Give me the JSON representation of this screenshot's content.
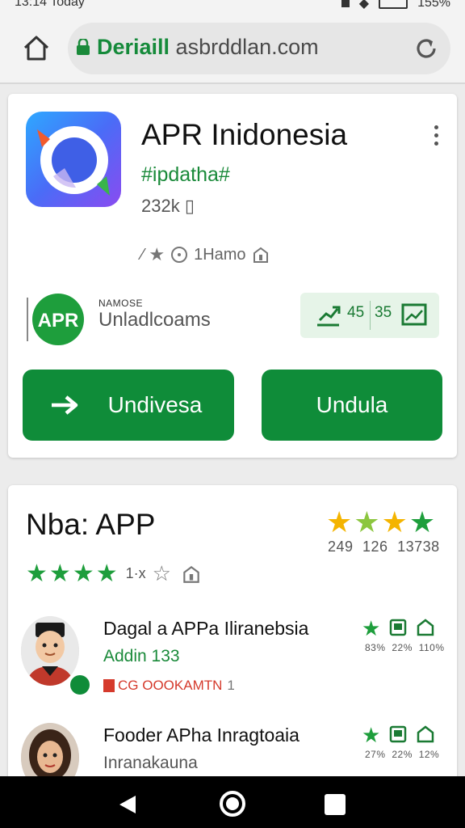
{
  "status_bar": {
    "time": "13:14",
    "extra": "Today",
    "battery": "155%"
  },
  "browser": {
    "url_domain": "Deriaill",
    "url_rest": " asbrddlan.com"
  },
  "app_card": {
    "title": "APR Inidonesia",
    "tag": "#ipdatha#",
    "size": "232k",
    "meta_text": "1Hamo",
    "publisher_small": "NAMOSE",
    "publisher_logo_text": "APR",
    "publisher_name": "Unladlcoams",
    "stat_1": "45",
    "stat_2": "35",
    "install_button": "Undivesa",
    "open_button": "Undula"
  },
  "section": {
    "title": "Nba: APP",
    "stats_numbers": "249 126  13738",
    "rating_text": "1·x"
  },
  "items": [
    {
      "title": "Dagal a APPa Iliranebsia",
      "subtitle": "Addin 133",
      "tag": "CG OOOKAMTN",
      "tag_num": "1",
      "pcts": "83% 22% 110%"
    },
    {
      "title": "Fooder APha Inragtoaia",
      "subtitle": "Inranakauna",
      "pcts": "27% 22% 12%"
    }
  ],
  "colors": {
    "accent_green": "#0f8c39",
    "star_yellow": "#f4b400",
    "star_green": "#1e9e3c"
  }
}
